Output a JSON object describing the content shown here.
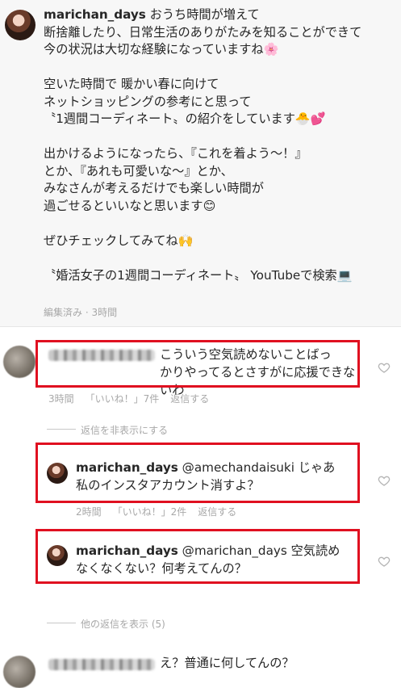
{
  "post": {
    "username": "marichan_days",
    "lines": [
      "おうち時間が増えて",
      "断捨離したり、日常生活のありがたみを知ることができて",
      "今の状況は大切な経験になっていますね🌸",
      "",
      "空いた時間で 暖かい春に向けて",
      "ネットショッピングの参考にと思って",
      "〝1週間コーディネート〟の紹介をしています🐣💕",
      "",
      "出かけるようになったら、『これを着よう〜！』",
      "とか、『あれも可愛いな〜』とか、",
      "みなさんが考えるだけでも楽しい時間が",
      "過ごせるといいなと思います😊",
      "",
      "ぜひチェックしてみてね🙌",
      "",
      "〝婚活女子の1週間コーディネート〟 YouTubeで検索💻"
    ],
    "meta": "編集済み · 3時間"
  },
  "comments": [
    {
      "text": "こういう空気読めないことばっ\nかりやってるとさすがに応援できないわ",
      "time": "3時間",
      "likes": "「いいね！」7件",
      "reply": "返信する"
    },
    {
      "username": "marichan_days",
      "mention": "@amechandaisuki",
      "text": "じゃあ\n私のインスタアカウント消すよ？",
      "time": "2時間",
      "likes": "「いいね！」2件",
      "reply": "返信する"
    },
    {
      "username": "marichan_days",
      "mention": "@marichan_days",
      "text": "空気読め\nなくなくない？何考えてんの？"
    },
    {
      "text": "え？普通に何してんの？"
    }
  ],
  "threads": {
    "hide_replies": "返信を非表示にする",
    "show_more": "他の返信を表示 (5)"
  },
  "colors": {
    "highlight": "#e01020",
    "muted": "#a8a8a8"
  },
  "icons": {
    "like": "heart-icon"
  }
}
